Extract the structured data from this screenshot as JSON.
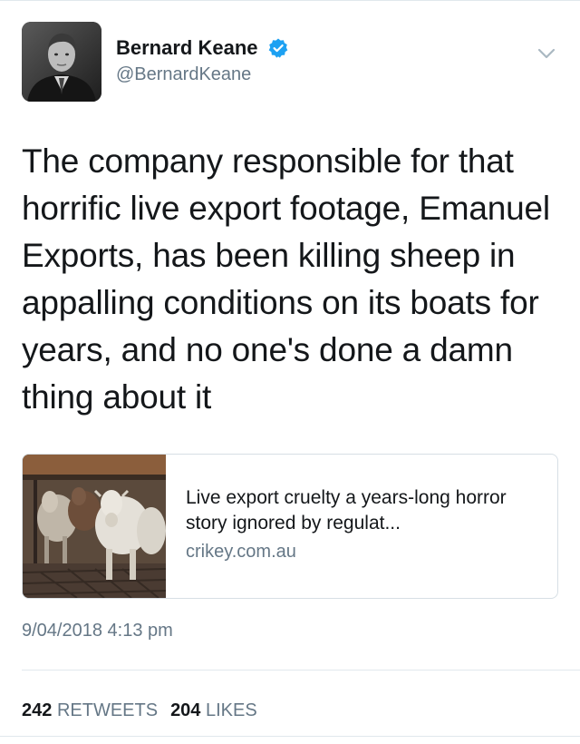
{
  "author": {
    "display_name": "Bernard Keane",
    "handle": "@BernardKeane",
    "verified_icon": "verified-badge-icon",
    "verified_color": "#1da1f2"
  },
  "tweet": {
    "text": "The company responsible for that horrific live export footage, Emanuel Exports, has been killing sheep in appalling conditions on its boats for years, and no one's done a damn thing about it",
    "timestamp": "9/04/2018 4:13 pm"
  },
  "card": {
    "title": "Live export cruelty a years-long horror story ignored by regulat...",
    "domain": "crikey.com.au"
  },
  "stats": {
    "retweets_count": "242",
    "retweets_label": "RETWEETS",
    "likes_count": "204",
    "likes_label": "LIKES"
  },
  "colors": {
    "text_primary": "#14171a",
    "text_secondary": "#657786",
    "border": "#e1e8ed"
  }
}
